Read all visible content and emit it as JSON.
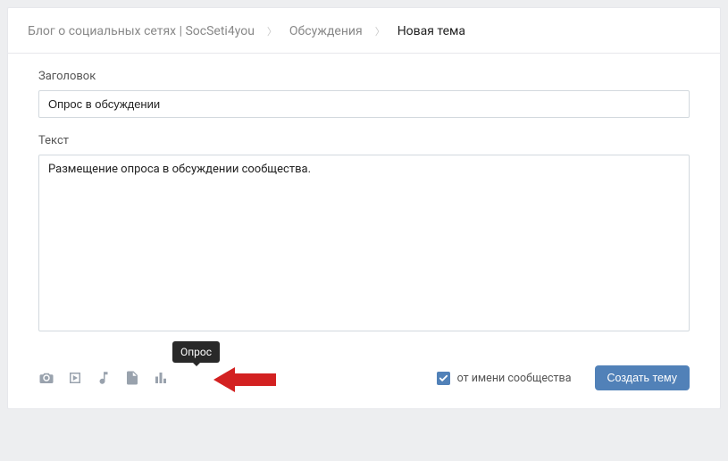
{
  "breadcrumbs": {
    "group": "Блог о социальных сетях | SocSeti4you",
    "section": "Обсуждения",
    "current": "Новая тема"
  },
  "form": {
    "title_label": "Заголовок",
    "title_value": "Опрос в обсуждении",
    "body_label": "Текст",
    "body_value": "Размещение опроса в обсуждении сообщества."
  },
  "attachments": {
    "photo": "Фото",
    "video": "Видео",
    "audio": "Аудио",
    "doc": "Документ",
    "poll": "Опрос"
  },
  "tooltip": "Опрос",
  "checkbox": {
    "label": "от имени сообщества",
    "checked": true
  },
  "submit_label": "Создать тему",
  "colors": {
    "accent": "#5181b8",
    "icon": "#99a2ad",
    "border": "#d3d9de"
  }
}
